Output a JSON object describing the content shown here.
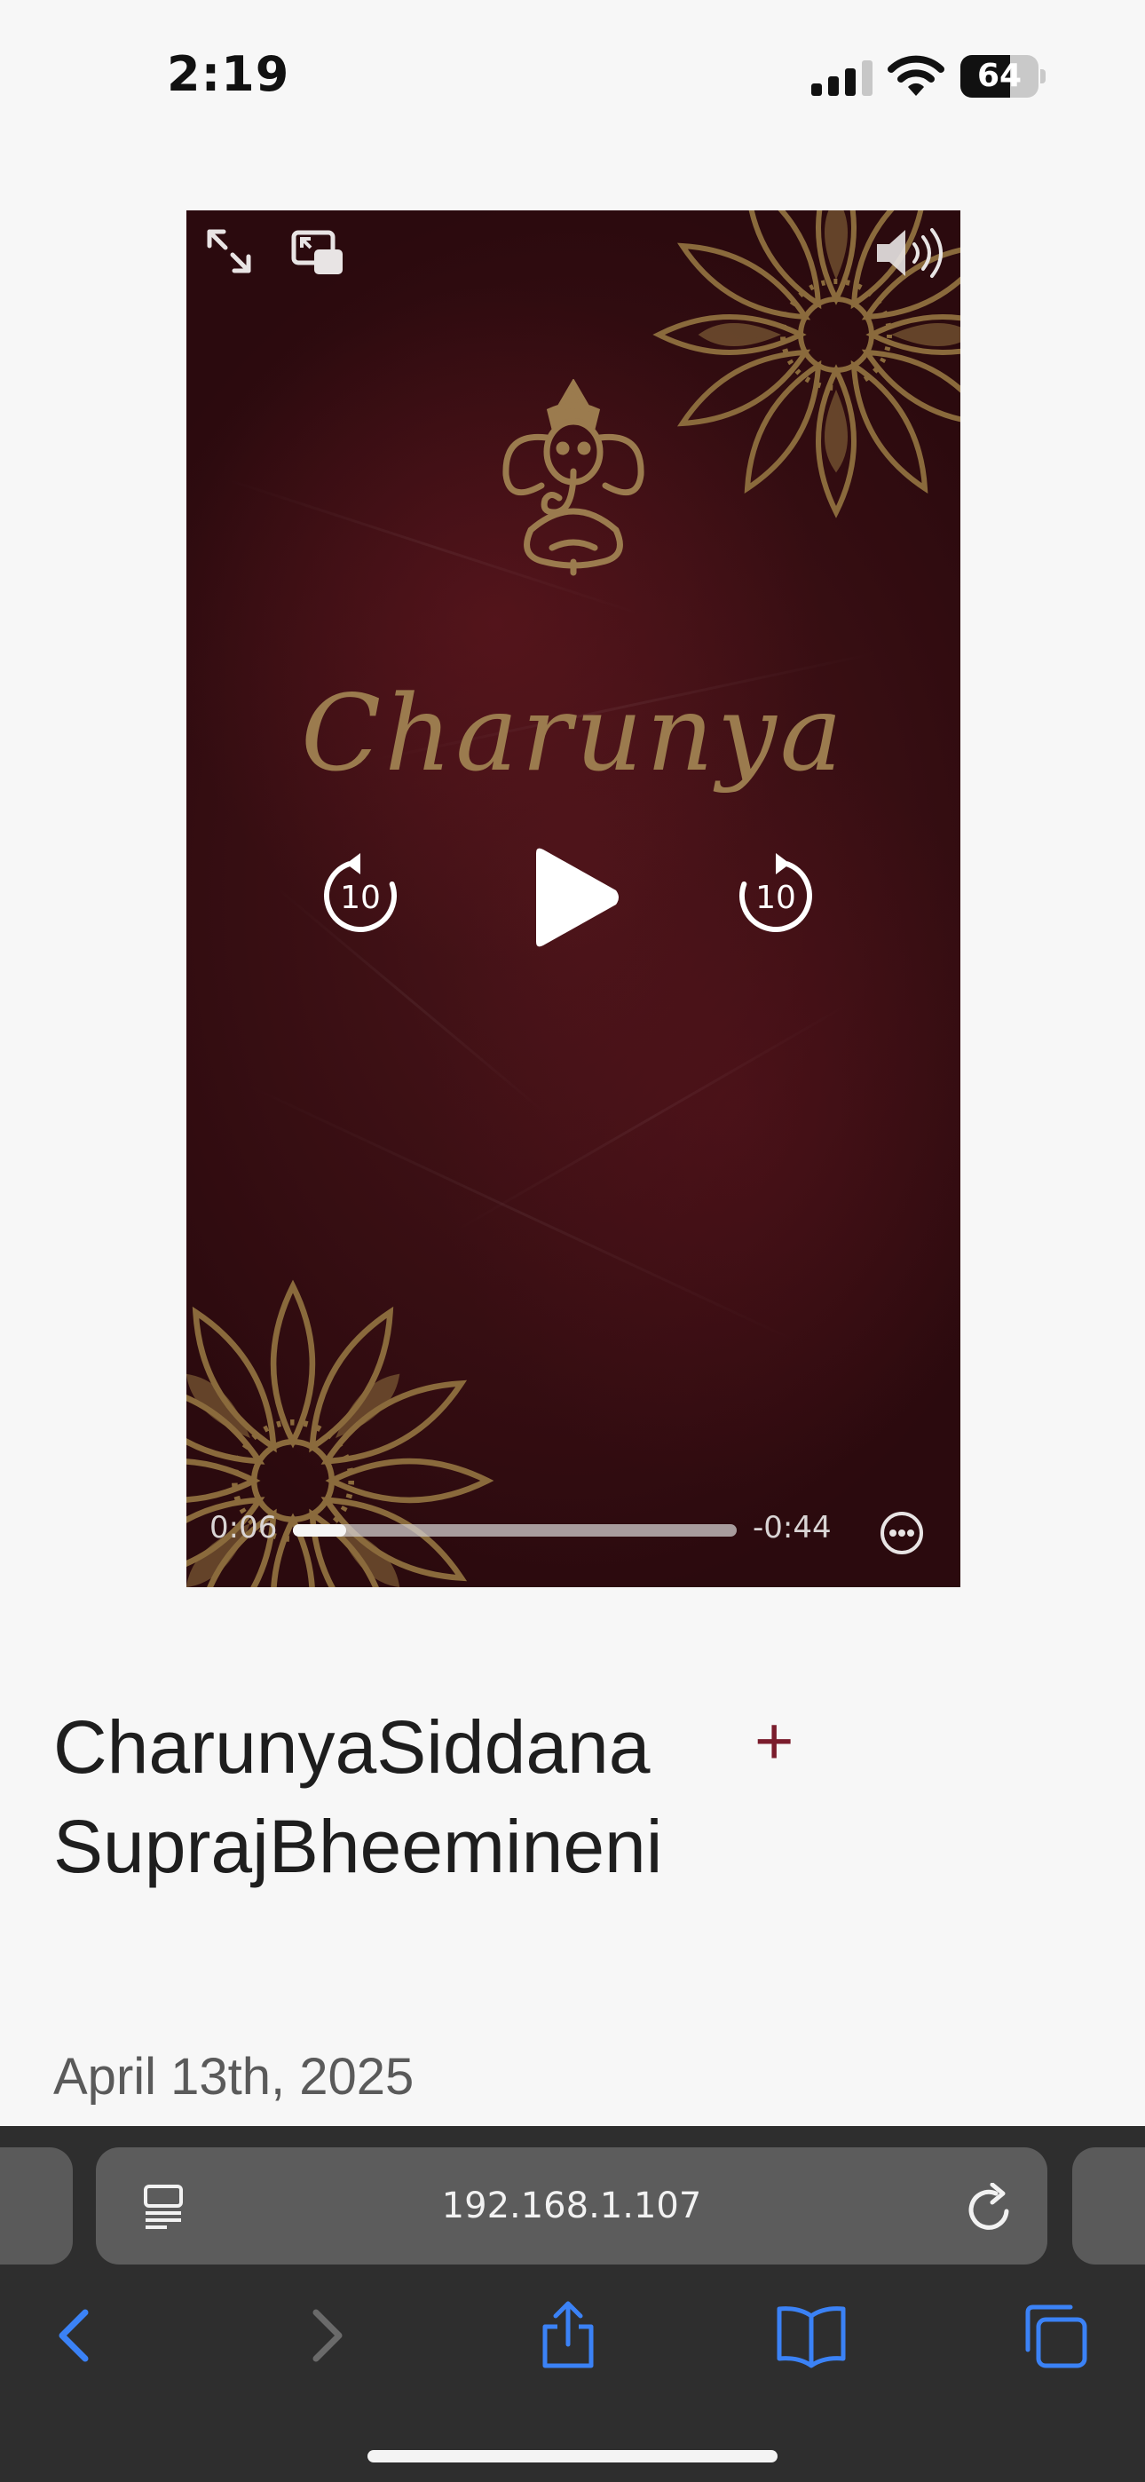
{
  "status_bar": {
    "time": "2:19",
    "battery_level": "64",
    "battery_fraction": 0.64
  },
  "video": {
    "title_text": "Charunya",
    "elapsed": "0:06",
    "remaining": "-0:44",
    "progress_fraction": 0.12,
    "skip_back_seconds": "10",
    "skip_forward_seconds": "10",
    "colors": {
      "background": "#3a0f14",
      "gold": "#9b7b4e"
    }
  },
  "content": {
    "names_line1": "CharunyaSiddana",
    "names_line2": "SuprajBheemineni",
    "plus_label": "+",
    "date": "April 13th, 2025"
  },
  "browser": {
    "url": "192.168.1.107",
    "accent_color": "#3b82f6"
  },
  "icons": [
    "expand-icon",
    "pip-icon",
    "volume-icon",
    "skip-back-icon",
    "play-icon",
    "skip-forward-icon",
    "more-icon",
    "reader-icon",
    "reload-icon",
    "back-icon",
    "forward-icon",
    "share-icon",
    "bookmarks-icon",
    "tabs-icon"
  ]
}
